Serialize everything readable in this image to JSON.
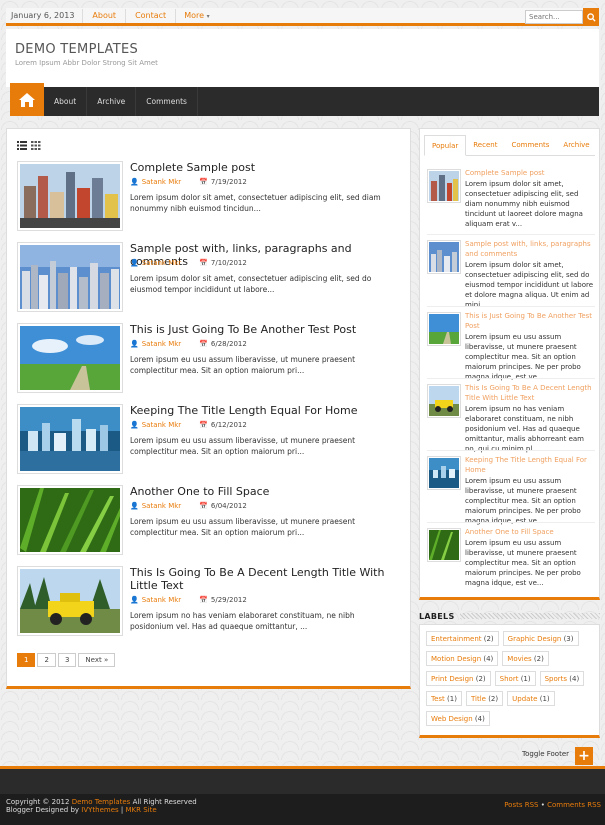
{
  "topbar": {
    "date": "January 6, 2013",
    "links": [
      "About",
      "Contact"
    ],
    "more": "More",
    "search_placeholder": "Search..."
  },
  "header": {
    "title": "DEMO TEMPLATES",
    "description": "Lorem Ipsum Abbr Dolor Strong Sit Amet"
  },
  "nav": {
    "items": [
      "About",
      "Archive",
      "Comments"
    ]
  },
  "posts": [
    {
      "title": "Complete Sample post",
      "author": "Satank Mkr",
      "date": "7/19/2012",
      "excerpt": "Lorem ipsum dolor sit amet, consectetuer adipiscing elit, sed diam nonummy nibh euismod tincidun..."
    },
    {
      "title": "Sample post with, links, paragraphs and comments",
      "author": "Satank Mkr",
      "date": "7/10/2012",
      "excerpt": "Lorem ipsum dolor sit amet, consectetuer adipiscing elit, sed do eiusmod tempor incididunt ut labore..."
    },
    {
      "title": "This is Just Going To Be Another Test Post",
      "author": "Satank Mkr",
      "date": "6/28/2012",
      "excerpt": "Lorem ipsum eu usu assum liberavisse, ut munere praesent complectitur mea. Sit an option maiorum pri..."
    },
    {
      "title": "Keeping The Title Length Equal For Home",
      "author": "Satank Mkr",
      "date": "6/12/2012",
      "excerpt": "Lorem ipsum eu usu assum liberavisse, ut munere praesent complectitur mea. Sit an option maiorum pri..."
    },
    {
      "title": "Another One to Fill Space",
      "author": "Satank Mkr",
      "date": "6/04/2012",
      "excerpt": "Lorem ipsum eu usu assum liberavisse, ut munere praesent complectitur mea. Sit an option maiorum pri..."
    },
    {
      "title": "This Is Going To Be A Decent Length Title With Little Text",
      "author": "Satank Mkr",
      "date": "5/29/2012",
      "excerpt": "Lorem ipsum no has veniam elaboraret constituam, ne nibh posidonium vel. Has ad quaeque omittantur, ..."
    }
  ],
  "pager": {
    "pages": [
      "1",
      "2",
      "3"
    ],
    "next": "Next »"
  },
  "sidebar": {
    "tabs": [
      "Popular",
      "Recent",
      "Comments",
      "Archive"
    ],
    "popular": [
      {
        "title": "Complete Sample post",
        "excerpt": "Lorem ipsum dolor sit amet, consectetuer adipiscing elit, sed diam nonummy nibh euismod tincidunt ut laoreet dolore magna aliquam erat v..."
      },
      {
        "title": "Sample post with, links, paragraphs and comments",
        "excerpt": "Lorem ipsum dolor sit amet, consectetuer adipiscing elit, sed do eiusmod tempor incididunt ut labore et dolore magna aliqua. Ut enim ad mini..."
      },
      {
        "title": "This is Just Going To Be Another Test Post",
        "excerpt": "Lorem ipsum eu usu assum liberavisse, ut munere praesent complectitur mea. Sit an option maiorum principes. Ne per probo magna idque, est ve..."
      },
      {
        "title": "This Is Going To Be A Decent Length Title With Little Text",
        "excerpt": "Lorem ipsum no has veniam elaboraret constituam, ne nibh posidonium vel. Has ad quaeque omittantur, malis abhorreant eam no, qui cu minim pl..."
      },
      {
        "title": "Keeping The Title Length Equal For Home",
        "excerpt": "Lorem ipsum eu usu assum liberavisse, ut munere praesent complectitur mea. Sit an option maiorum principes. Ne per probo magna idque, est ve..."
      },
      {
        "title": "Another One to Fill Space",
        "excerpt": "Lorem ipsum eu usu assum liberavisse, ut munere praesent complectitur mea. Sit an option maiorum principes. Ne per probo magna idque, est ve..."
      }
    ]
  },
  "labels": {
    "title": "LABELS",
    "items": [
      {
        "name": "Entertainment",
        "count": "(2)"
      },
      {
        "name": "Graphic Design",
        "count": "(3)"
      },
      {
        "name": "Motion Design",
        "count": "(4)"
      },
      {
        "name": "Movies",
        "count": "(2)"
      },
      {
        "name": "Print Design",
        "count": "(2)"
      },
      {
        "name": "Short",
        "count": "(1)"
      },
      {
        "name": "Sports",
        "count": "(4)"
      },
      {
        "name": "Test",
        "count": "(1)"
      },
      {
        "name": "Title",
        "count": "(2)"
      },
      {
        "name": "Update",
        "count": "(1)"
      },
      {
        "name": "Web Design",
        "count": "(4)"
      }
    ]
  },
  "toggle_footer": "Toggle Footer",
  "footer": {
    "copyright_prefix": "Copyright © 2012",
    "site_link": "Demo Templates",
    "rights": "All Right Reserved",
    "designed_by": "Blogger Designed by",
    "designer": "IVYthemes",
    "sep": "|",
    "mkr": "MKR Site",
    "posts_rss": "Posts RSS",
    "bullet": "•",
    "comments_rss": "Comments RSS"
  },
  "colors": {
    "accent": "#e87c0b",
    "dark": "#2b2b2b",
    "footer": "#1d1d1d"
  }
}
